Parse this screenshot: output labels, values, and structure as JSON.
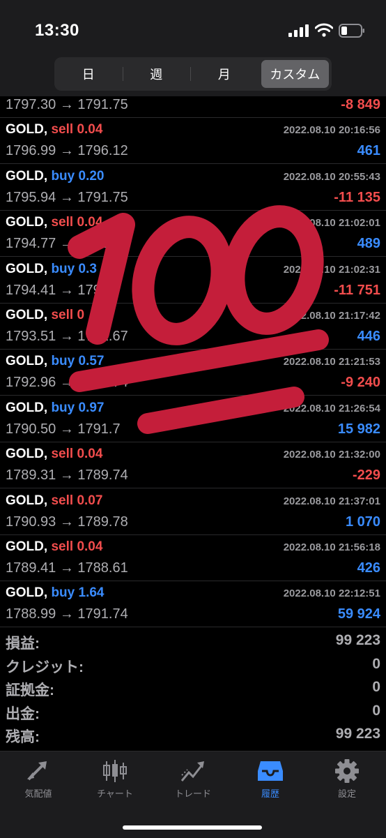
{
  "status_bar": {
    "time": "13:30"
  },
  "segments": [
    "日",
    "週",
    "月",
    "カスタム"
  ],
  "active_segment": "カスタム",
  "trades": [
    {
      "symbol": "",
      "type": "",
      "type_class": "",
      "volume": "",
      "date": "",
      "price": "1797.30 → 1791.75",
      "profit": "-8 849",
      "profit_class": "neg"
    },
    {
      "symbol": "GOLD,",
      "type": "sell",
      "type_class": "sell",
      "volume": "0.04",
      "date": "2022.08.10 20:16:56",
      "price": "1796.99 → 1796.12",
      "profit": "461",
      "profit_class": "pos"
    },
    {
      "symbol": "GOLD,",
      "type": "buy",
      "type_class": "buy",
      "volume": "0.20",
      "date": "2022.08.10 20:55:43",
      "price": "1795.94 → 1791.75",
      "profit": "-11 135",
      "profit_class": "neg"
    },
    {
      "symbol": "GOLD,",
      "type": "sell",
      "type_class": "sell",
      "volume": "0.04",
      "date": "2022.08.10 21:02:01",
      "price": "1794.77 → 1793.85",
      "profit": "489",
      "profit_class": "pos"
    },
    {
      "symbol": "GOLD,",
      "type": "buy",
      "type_class": "buy",
      "volume": "0.3",
      "date": "2022.08.10 21:02:31",
      "price": "1794.41 → 1791.",
      "profit": "-11 751",
      "profit_class": "neg"
    },
    {
      "symbol": "GOLD,",
      "type": "sell",
      "type_class": "sell",
      "volume": "0",
      "date": "2022.08.10 21:17:42",
      "price": "1793.51 → 1792.67",
      "profit": "446",
      "profit_class": "pos"
    },
    {
      "symbol": "GOLD,",
      "type": "buy",
      "type_class": "buy",
      "volume": "0.57",
      "date": "2022.08.10 21:21:53",
      "price": "1792.96 → 1791.74",
      "profit": "-9 240",
      "profit_class": "neg"
    },
    {
      "symbol": "GOLD,",
      "type": "buy",
      "type_class": "buy",
      "volume": "0.97",
      "date": "2022.08.10 21:26:54",
      "price": "1790.50 → 1791.7",
      "profit": "15 982",
      "profit_class": "pos"
    },
    {
      "symbol": "GOLD,",
      "type": "sell",
      "type_class": "sell",
      "volume": "0.04",
      "date": "2022.08.10 21:32:00",
      "price": "1789.31 → 1789.74",
      "profit": "-229",
      "profit_class": "neg"
    },
    {
      "symbol": "GOLD,",
      "type": "sell",
      "type_class": "sell",
      "volume": "0.07",
      "date": "2022.08.10 21:37:01",
      "price": "1790.93 → 1789.78",
      "profit": "1 070",
      "profit_class": "pos"
    },
    {
      "symbol": "GOLD,",
      "type": "sell",
      "type_class": "sell",
      "volume": "0.04",
      "date": "2022.08.10 21:56:18",
      "price": "1789.41 → 1788.61",
      "profit": "426",
      "profit_class": "pos"
    },
    {
      "symbol": "GOLD,",
      "type": "buy",
      "type_class": "buy",
      "volume": "1.64",
      "date": "2022.08.10 22:12:51",
      "price": "1788.99 → 1791.74",
      "profit": "59 924",
      "profit_class": "pos"
    }
  ],
  "summary": [
    {
      "label": "損益:",
      "value": "99 223"
    },
    {
      "label": "クレジット:",
      "value": "0"
    },
    {
      "label": "証拠金:",
      "value": "0"
    },
    {
      "label": "出金:",
      "value": "0"
    },
    {
      "label": "残高:",
      "value": "99 223"
    }
  ],
  "tabs": [
    {
      "label": "気配値",
      "icon": "quotes-arrows-icon"
    },
    {
      "label": "チャート",
      "icon": "candlestick-chart-icon"
    },
    {
      "label": "トレード",
      "icon": "trade-line-icon"
    },
    {
      "label": "履歴",
      "icon": "history-inbox-icon"
    },
    {
      "label": "設定",
      "icon": "gear-icon"
    }
  ],
  "active_tab": "履歴",
  "colors": {
    "sell": "#f24d4d",
    "buy": "#3a8cff",
    "emoji": "#c41e3a"
  },
  "overlay": {
    "icon": "hundred-points-emoji"
  }
}
